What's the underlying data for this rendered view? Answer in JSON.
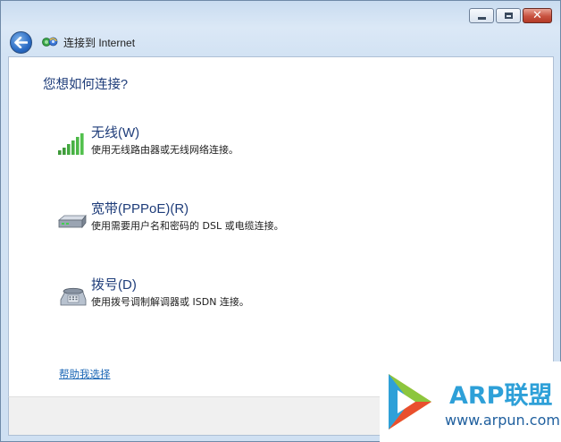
{
  "window": {
    "controls": {
      "minimize": "minimize",
      "maximize": "maximize",
      "close": "✕"
    }
  },
  "nav": {
    "title": "连接到 Internet"
  },
  "main": {
    "heading": "您想如何连接?",
    "options": [
      {
        "name": "无线(W)",
        "desc": "使用无线路由器或无线网络连接。",
        "icon": "wireless-signal-icon"
      },
      {
        "name": "宽带(PPPoE)(R)",
        "desc": "使用需要用户名和密码的 DSL 或电缆连接。",
        "icon": "broadband-modem-icon"
      },
      {
        "name": "拨号(D)",
        "desc": "使用拨号调制解调器或 ISDN 连接。",
        "icon": "dialup-phone-icon"
      }
    ],
    "help_link": "帮助我选择"
  },
  "watermark": {
    "brand": "ARP联盟",
    "url": "www.arpun.com"
  },
  "colors": {
    "heading": "#1f3d7a",
    "link": "#1a66b5",
    "accent": "#2ea0d8"
  }
}
